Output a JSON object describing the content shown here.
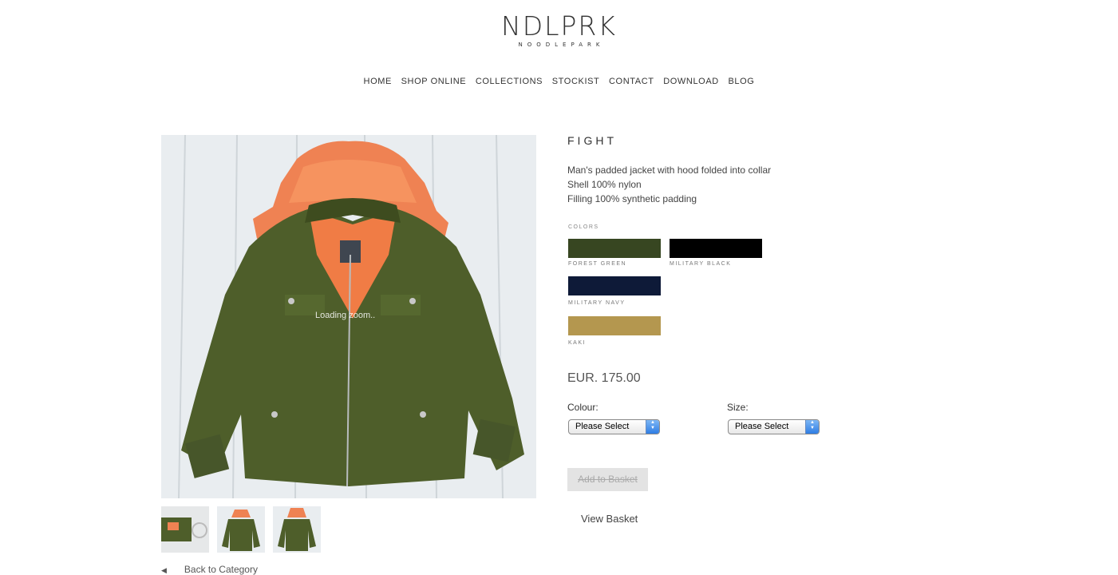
{
  "logo": {
    "main": "NDLPRK",
    "sub": "NOODLEPARK"
  },
  "nav": [
    "HOME",
    "SHOP ONLINE",
    "COLLECTIONS",
    "STOCKIST",
    "CONTACT",
    "DOWNLOAD",
    "BLOG"
  ],
  "product": {
    "title": "FIGHT",
    "description": [
      "Man's padded jacket with hood folded into collar",
      "Shell 100% nylon",
      "Filling 100% synthetic padding"
    ],
    "loading_text": "Loading zoom..",
    "thumbnail_icons": [
      "hood-thumbnail",
      "front-thumbnail",
      "back-thumbnail"
    ]
  },
  "colors": {
    "label": "COLORS",
    "items": [
      {
        "name": "FOREST GREEN",
        "hex": "#374621"
      },
      {
        "name": "MILITARY BLACK",
        "hex": "#000000"
      },
      {
        "name": "MILITARY NAVY",
        "hex": "#0e1a38"
      },
      {
        "name": "KAKI",
        "hex": "#b4974f"
      }
    ]
  },
  "price": "EUR. 175.00",
  "colour_select": {
    "label": "Colour:",
    "value": "Please Select"
  },
  "size_select": {
    "label": "Size:",
    "value": "Please Select"
  },
  "buttons": {
    "add_to_basket": "Add to Basket",
    "view_basket": "View Basket"
  },
  "back_link": "Back to Category"
}
